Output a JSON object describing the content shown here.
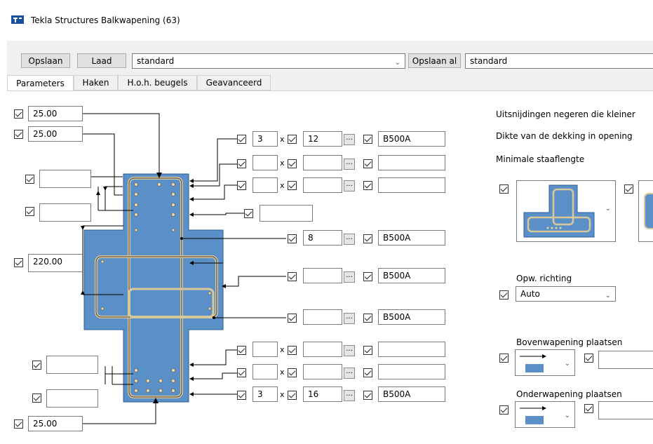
{
  "window": {
    "title": "Tekla Structures  Balkwapening (63)"
  },
  "toolbar": {
    "save_label": "Opslaan",
    "load_label": "Laad",
    "preset_value": "standard",
    "save_as_label": "Opslaan al",
    "save_as_value": "standard"
  },
  "tabs": [
    "Parameters",
    "Haken",
    "H.o.h. beugels",
    "Geavanceerd"
  ],
  "left_fields": {
    "top_cover_1": "25.00",
    "top_cover_2": "25.00",
    "side_a": "",
    "side_b": "",
    "height": "220.00",
    "bottom_a": "",
    "bottom_b": "",
    "bottom_cover": "25.00"
  },
  "rows": {
    "r1": {
      "count": "3",
      "size": "12",
      "grade": "B500A"
    },
    "r2": {
      "count": "",
      "size": "",
      "grade": ""
    },
    "r3": {
      "count": "",
      "size": "",
      "grade": ""
    },
    "r4": {
      "value": ""
    },
    "r5": {
      "size": "8",
      "grade": "B500A"
    },
    "r6": {
      "size": "",
      "grade": "B500A"
    },
    "r7": {
      "size": "",
      "grade": "B500A"
    },
    "r8": {
      "count": "",
      "size": "",
      "grade": ""
    },
    "r9": {
      "count": "",
      "size": "",
      "grade": ""
    },
    "r10": {
      "count": "3",
      "size": "16",
      "grade": "B500A"
    }
  },
  "right": {
    "ignore_cutouts": "Uitsnijdingen negeren die kleiner",
    "cover_thickness": "Dikte van de dekking in opening",
    "min_bar_length": "Minimale staaflengte",
    "direction_label": "Opw. richting",
    "direction_value": "Auto",
    "top_place_label": "Bovenwapening plaatsen",
    "bottom_place_label": "Onderwapening plaatsen"
  },
  "glyphs": {
    "x": "x",
    "dots": "..."
  },
  "colors": {
    "concrete": "#5b8fc7",
    "bar": "#d9c89a",
    "field_border": "#7a7a7a"
  }
}
